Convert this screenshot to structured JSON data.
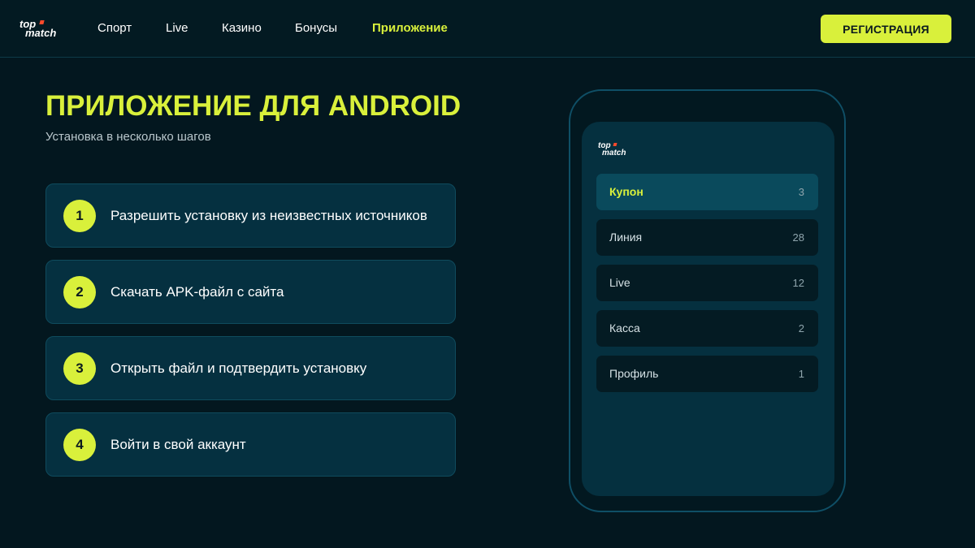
{
  "header": {
    "logo_line1": "top",
    "logo_line2": "match",
    "nav": [
      {
        "label": "Спорт"
      },
      {
        "label": "Live"
      },
      {
        "label": "Казино"
      },
      {
        "label": "Бонусы"
      },
      {
        "label": "Приложение",
        "active": true
      }
    ],
    "register_label": "РЕГИСТРАЦИЯ"
  },
  "main": {
    "title": "ПРИЛОЖЕНИЕ ДЛЯ ANDROID",
    "subtitle": "Установка в несколько шагов",
    "steps": [
      {
        "number": "1",
        "text": "Разрешить установку из неизвестных источников"
      },
      {
        "number": "2",
        "text": "Скачать APK-файл с сайта"
      },
      {
        "number": "3",
        "text": "Открыть файл и подтвердить установку"
      },
      {
        "number": "4",
        "text": "Войти в свой аккаунт"
      }
    ]
  },
  "phone": {
    "logo_line1": "top",
    "logo_line2": "match",
    "menu": [
      {
        "label": "Купон",
        "count": "3",
        "active": true
      },
      {
        "label": "Линия",
        "count": "28"
      },
      {
        "label": "Live",
        "count": "12"
      },
      {
        "label": "Касса",
        "count": "2"
      },
      {
        "label": "Профиль",
        "count": "1"
      }
    ]
  },
  "colors": {
    "background": "#03171f",
    "accent": "#d9f03b",
    "card": "#053040",
    "logo_mark": "#ff4a2b"
  }
}
